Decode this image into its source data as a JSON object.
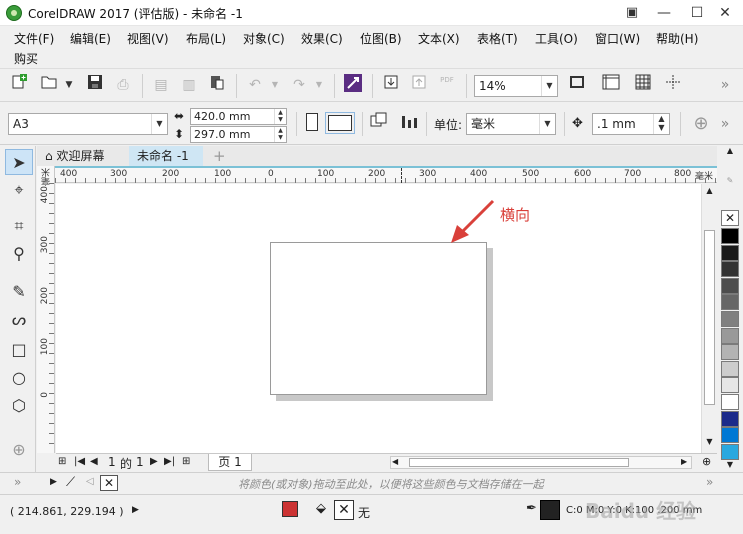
{
  "window": {
    "title": "CorelDRAW 2017 (评估版) - 未命名 -1",
    "controls": {
      "minimize": "—",
      "maximize": "☐",
      "close": "✕"
    }
  },
  "menu": {
    "items": [
      "文件(F)",
      "编辑(E)",
      "视图(V)",
      "布局(L)",
      "对象(C)",
      "效果(C)",
      "位图(B)",
      "文本(X)",
      "表格(T)",
      "工具(O)",
      "窗口(W)",
      "帮助(H)",
      "购买"
    ]
  },
  "standard_toolbar": {
    "zoom_value": "14%",
    "icons": [
      "new-icon",
      "open-icon",
      "save-icon",
      "print-icon",
      "cut-icon",
      "copy-icon",
      "paste-icon",
      "undo-icon",
      "redo-icon",
      "search-content-icon",
      "import-icon",
      "export-icon",
      "publish-pdf-icon",
      "full-screen-icon",
      "rulers-icon",
      "grid-icon",
      "guidelines-icon"
    ],
    "pdf_label": "PDF"
  },
  "property_bar": {
    "page_size": "A3",
    "width": "420.0 mm",
    "height": "297.0 mm",
    "unit_label": "单位:",
    "unit_value": "毫米",
    "nudge_value": ".1 mm"
  },
  "document_tabs": [
    {
      "label": "欢迎屏幕",
      "active": false
    },
    {
      "label": "未命名 -1",
      "active": true
    }
  ],
  "rulers": {
    "horizontal_labels": [
      "400",
      "300",
      "200",
      "100",
      "0",
      "100",
      "200",
      "300",
      "400",
      "500",
      "600",
      "700",
      "800"
    ],
    "horizontal_unit": "毫米",
    "vertical_labels": [
      "400",
      "300",
      "200",
      "100",
      "0"
    ],
    "vertical_unit": "毫米"
  },
  "annotation": {
    "text": "横向",
    "color": "#d9403a"
  },
  "page_navigator": {
    "current": "1",
    "of_label": "的",
    "total": "1",
    "page_tab": "页 1"
  },
  "color_bar": {
    "hint": "将颜色(或对象)拖动至此处，以便将这些颜色与文档存储在一起"
  },
  "status": {
    "coordinates": "( 214.861, 229.194 )",
    "fill_label": "无",
    "fill_value": "C:0 M:0 Y:0 K:100 .200 mm",
    "watermark": "Baidu 经验"
  },
  "palette_colors": [
    "#000000",
    "#1a1a1a",
    "#333333",
    "#4d4d4d",
    "#666666",
    "#808080",
    "#999999",
    "#b3b3b3",
    "#cccccc",
    "#e6e6e6",
    "#ffffff",
    "#1b2a8a",
    "#0078d4",
    "#29a8e0"
  ]
}
